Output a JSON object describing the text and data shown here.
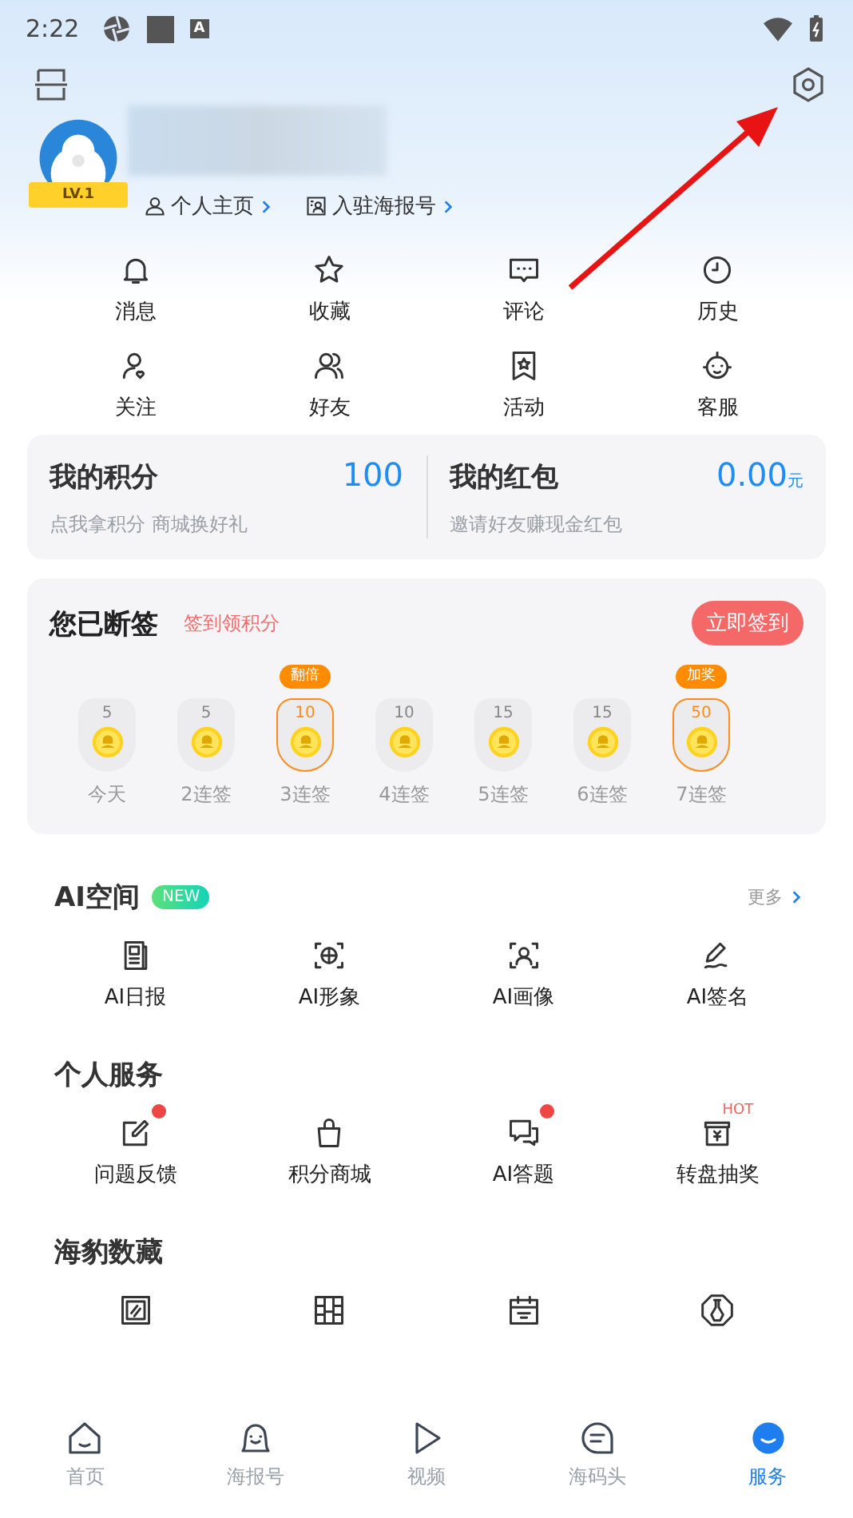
{
  "status_bar": {
    "time": "2:22",
    "notification_letter": "A"
  },
  "profile": {
    "level": "LV.1",
    "links": [
      {
        "label": "个人主页"
      },
      {
        "label": "入驻海报号"
      }
    ]
  },
  "quick_actions": [
    {
      "label": "消息"
    },
    {
      "label": "收藏"
    },
    {
      "label": "评论"
    },
    {
      "label": "历史"
    },
    {
      "label": "关注"
    },
    {
      "label": "好友"
    },
    {
      "label": "活动"
    },
    {
      "label": "客服"
    }
  ],
  "wallet": [
    {
      "title": "我的积分",
      "value": "100",
      "subtitle": "点我拿积分 商城换好礼"
    },
    {
      "title": "我的红包",
      "value": "0.00",
      "unit": "元",
      "subtitle": "邀请好友赚现金红包"
    }
  ],
  "checkin": {
    "title": "您已断签",
    "hint": "签到领积分",
    "button": "立即签到",
    "days": [
      {
        "points": "5",
        "label": "今天",
        "highlighted": false
      },
      {
        "points": "5",
        "label": "2连签",
        "highlighted": false
      },
      {
        "points": "10",
        "label": "3连签",
        "highlighted": true,
        "badge": "翻倍"
      },
      {
        "points": "10",
        "label": "4连签",
        "highlighted": false
      },
      {
        "points": "15",
        "label": "5连签",
        "highlighted": false
      },
      {
        "points": "15",
        "label": "6连签",
        "highlighted": false
      },
      {
        "points": "50",
        "label": "7连签",
        "highlighted": true,
        "badge": "加奖"
      }
    ]
  },
  "ai_space": {
    "title": "AI空间",
    "badge": "NEW",
    "more": "更多",
    "items": [
      {
        "label": "AI日报"
      },
      {
        "label": "AI形象"
      },
      {
        "label": "AI画像"
      },
      {
        "label": "AI签名"
      }
    ]
  },
  "personal_services": {
    "title": "个人服务",
    "items": [
      {
        "label": "问题反馈",
        "dot": true
      },
      {
        "label": "积分商城",
        "dot": false
      },
      {
        "label": "AI答题",
        "dot": true
      },
      {
        "label": "转盘抽奖",
        "dot": false,
        "badge": "HOT"
      }
    ]
  },
  "collections": {
    "title": "海豹数藏"
  },
  "bottom_nav": [
    {
      "label": "首页",
      "selected": false
    },
    {
      "label": "海报号",
      "selected": false
    },
    {
      "label": "视频",
      "selected": false
    },
    {
      "label": "海码头",
      "selected": false
    },
    {
      "label": "服务",
      "selected": true
    }
  ]
}
